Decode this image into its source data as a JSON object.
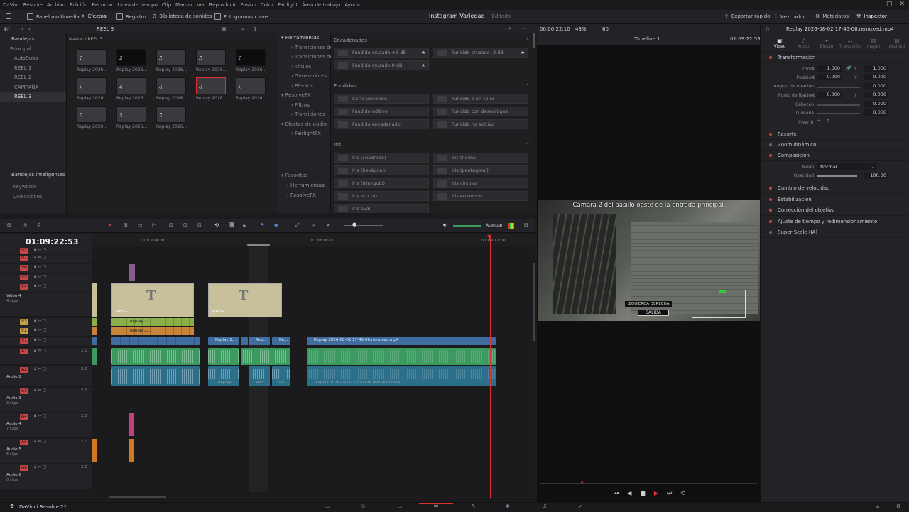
{
  "menu": [
    "DaVinci Resolve",
    "Archivo",
    "Edición",
    "Recortar",
    "Línea de tiempo",
    "Clip",
    "Marcar",
    "Ver",
    "Reproducir",
    "Fusion",
    "Color",
    "Fairlight",
    "Área de trabajo",
    "Ayuda"
  ],
  "toolbar": {
    "media_pool": "Panel multimedia",
    "effects": "Efectos",
    "index": "Registro",
    "sound_library": "Biblioteca de sonidos",
    "keyframes": "Fotogramas clave",
    "project_title": "Instagram Variedad",
    "project_status": "Editado",
    "quick_export": "Exportar rápido",
    "mixer": "Mezclador",
    "metadata": "Metadatos",
    "inspector": "Inspector"
  },
  "media": {
    "reel": "REEL 3",
    "path": "Master / REEL 3",
    "bins_label": "Bandejas",
    "bins": [
      {
        "label": "Principal",
        "selected": false,
        "indent": 0
      },
      {
        "label": "AutoSubs",
        "selected": false,
        "indent": 1
      },
      {
        "label": "REEL 1",
        "selected": false,
        "indent": 1
      },
      {
        "label": "REEL 2",
        "selected": false,
        "indent": 1
      },
      {
        "label": "CAMPAÑA",
        "selected": false,
        "indent": 1
      },
      {
        "label": "REEL 3",
        "selected": true,
        "indent": 1
      }
    ],
    "smart_bins": "Bandejas inteligentes",
    "smart_items": [
      "Keywords",
      "Colecciones"
    ],
    "clip_label": "Replay 2026..."
  },
  "effects": {
    "tree": [
      {
        "label": "Herramientas",
        "level": 0
      },
      {
        "label": "Transiciones de...",
        "level": 1
      },
      {
        "label": "Transiciones de...",
        "level": 1
      },
      {
        "label": "Títulos",
        "level": 1
      },
      {
        "label": "Generadores",
        "level": 1
      },
      {
        "label": "Efectos",
        "level": 1
      },
      {
        "label": "ResolveFX",
        "level": 0
      },
      {
        "label": "Filtros",
        "level": 1
      },
      {
        "label": "Transiciones",
        "level": 1
      },
      {
        "label": "Efectos de audio",
        "level": 0
      },
      {
        "label": "FairlightFX",
        "level": 1
      }
    ],
    "favorites": "Favoritos",
    "fav_items": [
      "Herramientas",
      "ResolveFX"
    ],
    "sections": {
      "encadenados": "Encadenados",
      "fundidos": "Fundidos",
      "iris": "Iris"
    },
    "encadenados": [
      "Fundido cruzado +3 dB",
      "Fundido cruzado -3 dB",
      "Fundido cruzado 0 dB"
    ],
    "fundidos": [
      "Corte uniforme",
      "Fundido a un color",
      "Fundido aditivo",
      "Fundido con desenfoque",
      "Fundido encadenado",
      "Fundido no aditivo"
    ],
    "iris": [
      "Iris (cuadrado)",
      "Iris (flecha)",
      "Iris (hexágono)",
      "Iris (pentágono)",
      "Iris (triángulo)",
      "Iris circular",
      "Iris en cruz",
      "Iris en rombo",
      "Iris oval"
    ]
  },
  "viewer": {
    "timecode_left": "00:00:22:10",
    "zoom": "43%",
    "fps": "60",
    "timeline_name": "Timeline 1",
    "timecode_right": "01:09:22:53",
    "subtitle": "Cámara 2 del pasillo oeste de la entrada principal.",
    "hud_top": "IZQUIERDA DERECHA",
    "hud_exit": "SALIDA"
  },
  "inspector": {
    "clip_name": "Replay 2026-08-02 17-45-06.remuxed.mp4",
    "tabs": [
      "Video",
      "Audio",
      "Efecto",
      "Transición",
      "Imagen",
      "Archivo"
    ],
    "transform": "Transformación",
    "zoom_label": "Zoom",
    "zoom_x": "1.000",
    "zoom_y": "1.000",
    "position_label": "Posición",
    "pos_x": "0.000",
    "pos_y": "0.000",
    "rotation_label": "Ángulo de rotación",
    "rotation": "0.000",
    "anchor_label": "Punto de fijación",
    "anchor_x": "0.000",
    "anchor_y": "0.000",
    "pitch_label": "Cabeceo",
    "pitch": "0.000",
    "yaw_label": "Guiñada",
    "yaw": "0.000",
    "flip_label": "Invertir",
    "sections": [
      "Recorte",
      "Zoom dinámico",
      "Composición"
    ],
    "mode_label": "Modo",
    "mode": "Normal",
    "opacity_label": "Opacidad",
    "opacity": "100.00",
    "sections2": [
      "Cambio de velocidad",
      "Estabilización",
      "Corrección del objetivo",
      "Ajuste de tiempo y redimensionamiento",
      "Super Scale (IA)"
    ]
  },
  "timeline": {
    "timecode": "01:09:22:53",
    "ruler": [
      "01:03:04:00",
      "01:06:06:00",
      "01:09:12:00"
    ],
    "attenuate": "Atenuar",
    "video_tracks": [
      "V7",
      "V6",
      "V5",
      "V4"
    ],
    "v4_name": "Video 4",
    "v4_clips": "4 clips",
    "v_lower": [
      "V3",
      "V2"
    ],
    "v1": "V1",
    "a1": "A1",
    "a2": "A2",
    "a2_name": "Audio 2",
    "a3": "A3",
    "a3_name": "Audio 3",
    "a3_clips": "3 clips",
    "a4": "A4",
    "a4_name": "Audio 4",
    "a4_clips": "7 clips",
    "a5": "A5",
    "a5_name": "Audio 5",
    "a5_clips": "6 clips",
    "a6": "A6",
    "a6_name": "Audio 6",
    "a6_clips": "0 clips",
    "level": "2.0",
    "text_clip": "Texto+",
    "clip_short": "Replay 2...",
    "clip_short2": "Rep...",
    "clip_short3": "Re...",
    "clip_long": "Replay 2026-08-02 17-45-06.remuxed.mp4",
    "title_glyph": "T"
  },
  "bottom": {
    "app": "DaVinci Resolve 21"
  }
}
